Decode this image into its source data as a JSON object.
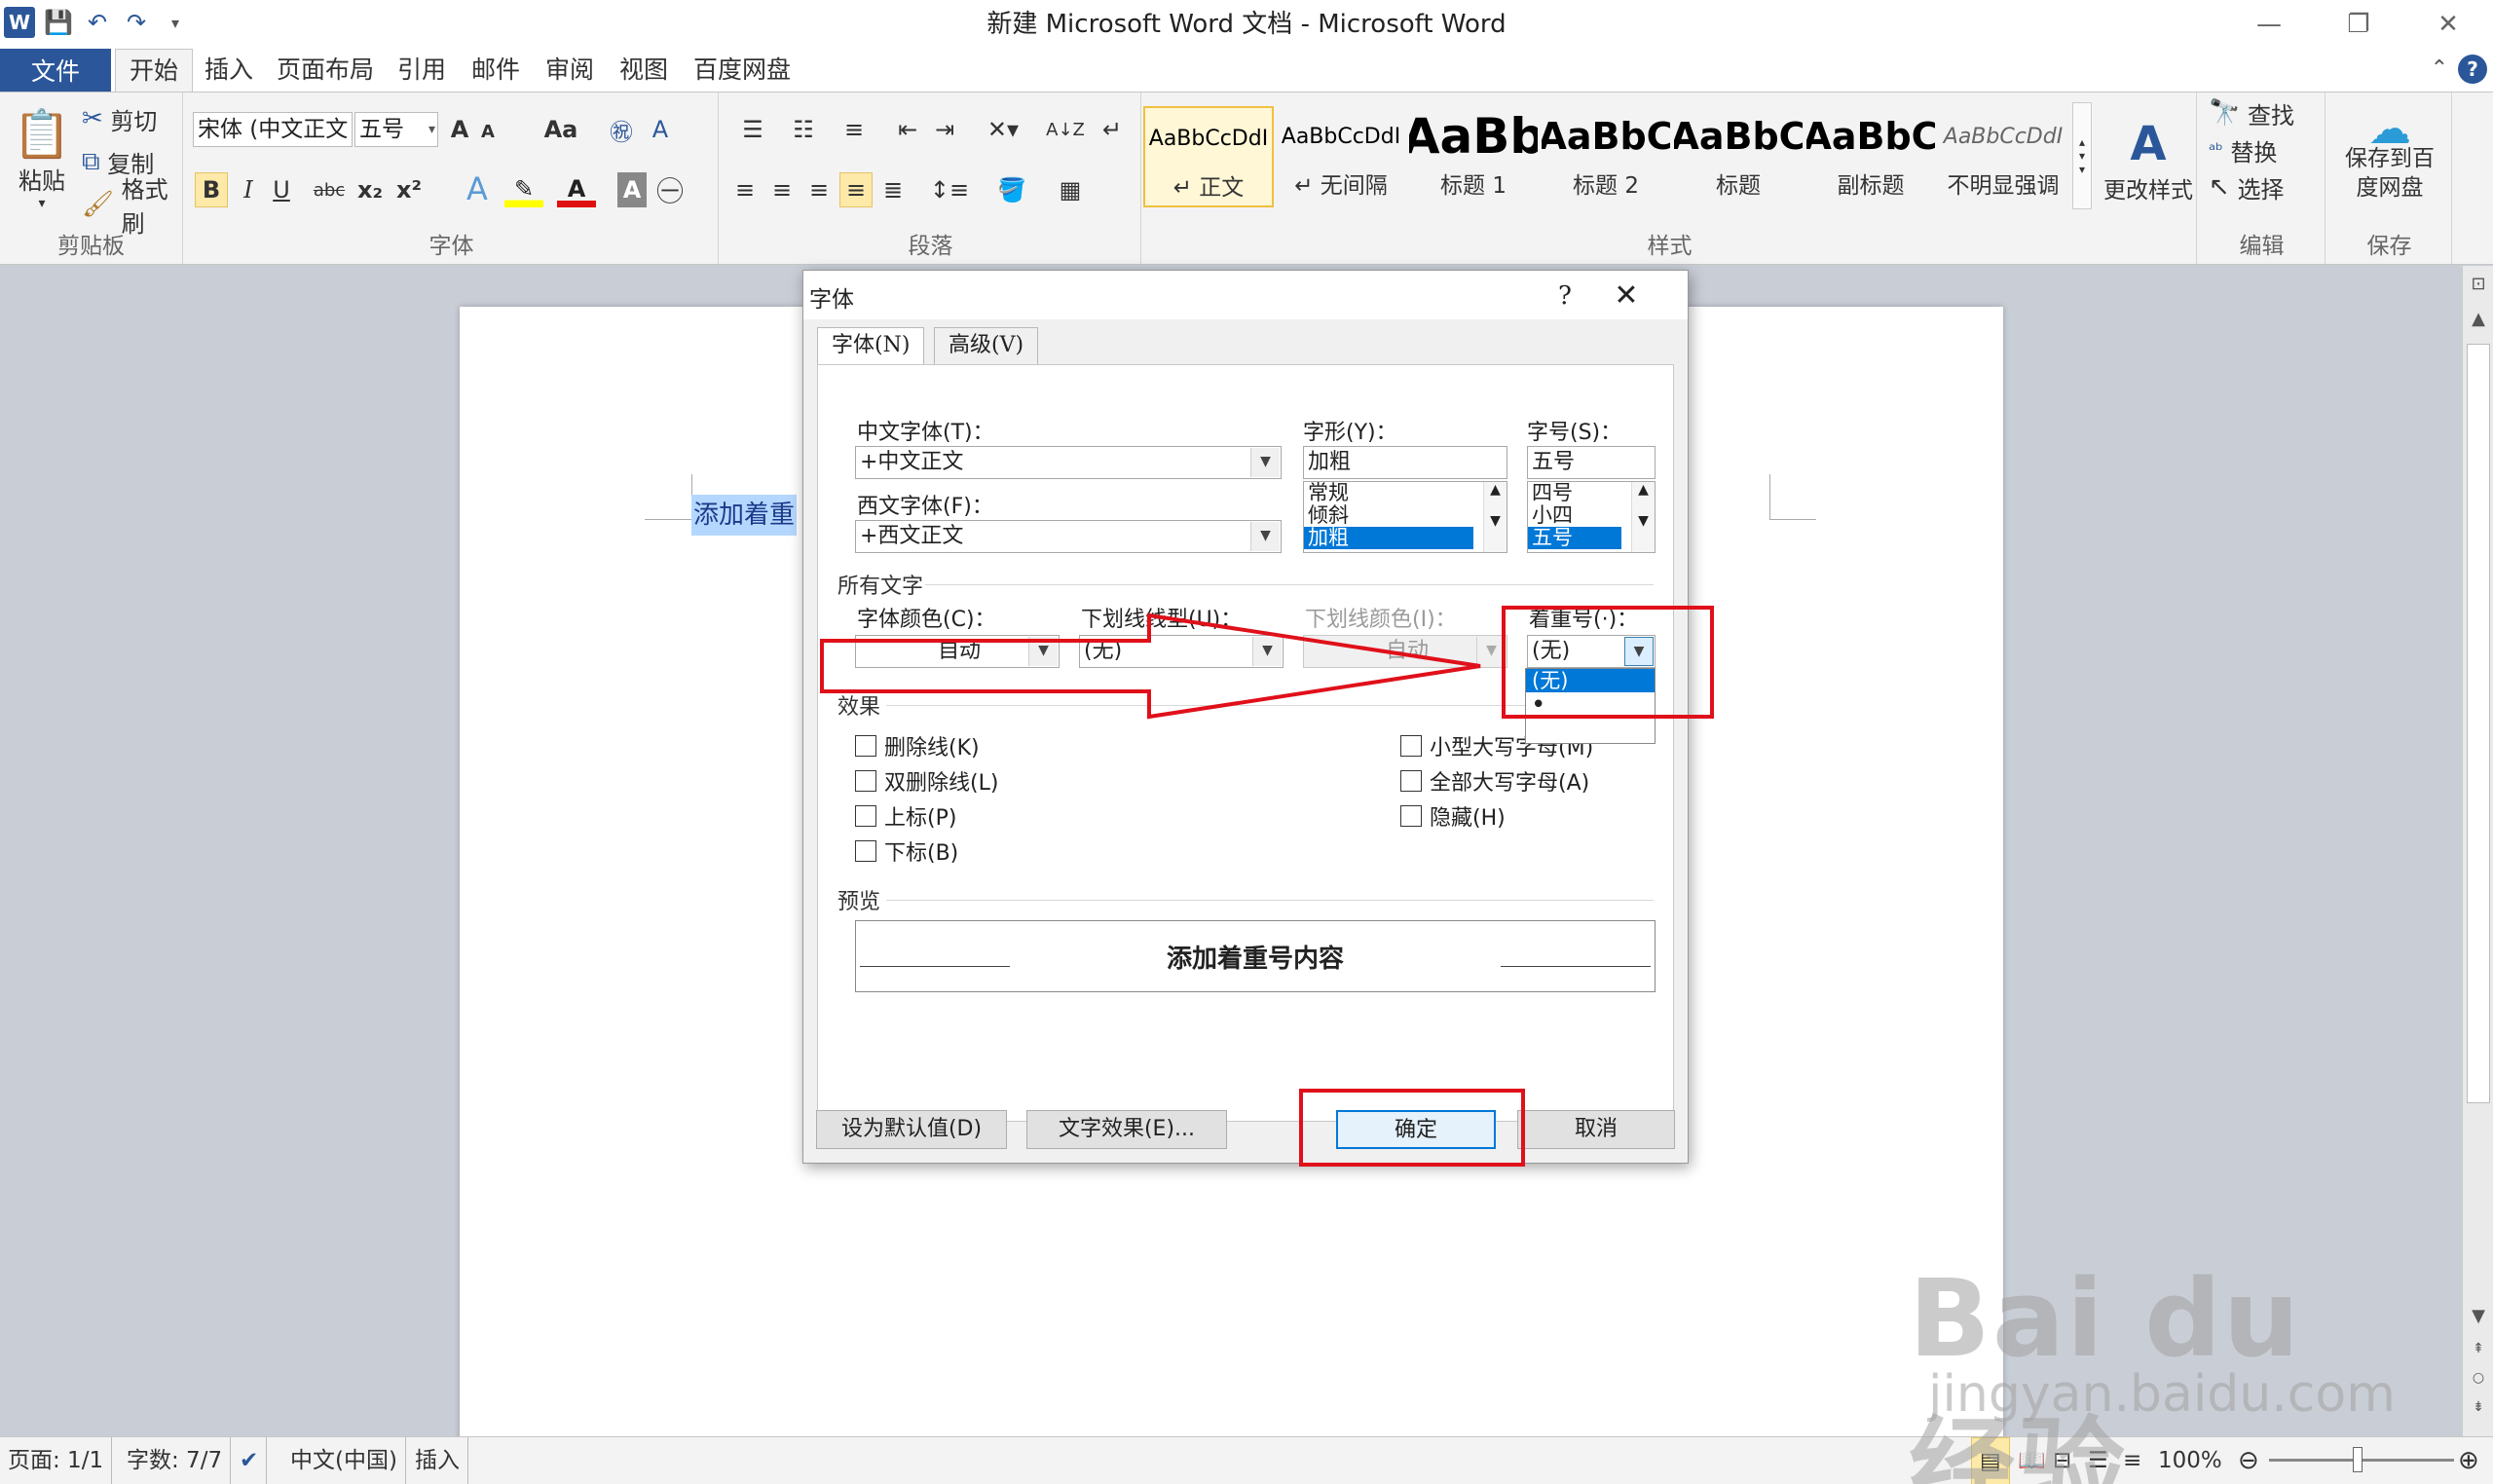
{
  "window": {
    "title": "新建 Microsoft Word 文档 - Microsoft Word",
    "minimize": "—",
    "restore": "❐",
    "close": "✕"
  },
  "qat": {
    "word_logo": "W",
    "save": "💾",
    "undo": "↶",
    "redo": "↷",
    "customize": "▾"
  },
  "tabs": {
    "file": "文件",
    "items": [
      "开始",
      "插入",
      "页面布局",
      "引用",
      "邮件",
      "审阅",
      "视图",
      "百度网盘"
    ],
    "active": "开始",
    "help": "?",
    "collapse": "⌃"
  },
  "ribbon": {
    "clipboard": {
      "label": "剪贴板",
      "paste": "粘贴",
      "cut": "剪切",
      "copy": "复制",
      "format_painter": "格式刷"
    },
    "font": {
      "label": "字体",
      "font_name": "宋体 (中文正文",
      "font_size": "五号",
      "grow": "A",
      "shrink": "A",
      "change_case": "Aa",
      "clear_format": "A",
      "bold": "B",
      "italic": "I",
      "underline": "U",
      "strike": "abc",
      "subscript": "x₂",
      "superscript": "x²",
      "text_effect": "A",
      "highlight": "✎",
      "font_color": "A",
      "char_shading": "A",
      "enclose": "㊀"
    },
    "paragraph": {
      "label": "段落",
      "sort": "A↓Z",
      "show_marks": "↵"
    },
    "styles": {
      "label": "样式",
      "items": [
        {
          "sample": "AaBbCcDdI",
          "name": "正文",
          "mark": "↵"
        },
        {
          "sample": "AaBbCcDdI",
          "name": "无间隔",
          "mark": "↵"
        },
        {
          "sample": "AaBb",
          "name": "标题 1"
        },
        {
          "sample": "AaBbC",
          "name": "标题 2"
        },
        {
          "sample": "AaBbC",
          "name": "标题"
        },
        {
          "sample": "AaBbC",
          "name": "副标题"
        },
        {
          "sample": "AaBbCcDdI",
          "name": "不明显强调"
        }
      ],
      "change_styles": "更改样式"
    },
    "editing": {
      "label": "编辑",
      "find": "查找",
      "replace": "替换",
      "select": "选择"
    },
    "save": {
      "label": "保存",
      "button_line1": "保存到百",
      "button_line2": "度网盘"
    }
  },
  "document": {
    "text": "添加着重"
  },
  "dialog": {
    "title": "字体",
    "help": "?",
    "close": "✕",
    "tabs": [
      "字体(N)",
      "高级(V)"
    ],
    "chinese_font_label": "中文字体(T)：",
    "chinese_font_value": "+中文正文",
    "western_font_label": "西文字体(F)：",
    "western_font_value": "+西文正文",
    "style_label": "字形(Y)：",
    "style_value": "加粗",
    "style_list": [
      "常规",
      "倾斜",
      "加粗"
    ],
    "style_selected": 2,
    "size_label": "字号(S)：",
    "size_value": "五号",
    "size_list": [
      "四号",
      "小四",
      "五号"
    ],
    "size_selected": 2,
    "all_text_section": "所有文字",
    "font_color_label": "字体颜色(C)：",
    "font_color_value": "自动",
    "underline_style_label": "下划线线型(U)：",
    "underline_style_value": "(无)",
    "underline_color_label": "下划线颜色(I)：",
    "underline_color_value": "自动",
    "emphasis_label": "着重号(·)：",
    "emphasis_value": "(无)",
    "emphasis_options": [
      "(无)",
      "•"
    ],
    "emphasis_selected": 0,
    "effects_section": "效果",
    "effects_left": [
      "删除线(K)",
      "双删除线(L)",
      "上标(P)",
      "下标(B)"
    ],
    "effects_right": [
      "小型大写字母(M)",
      "全部大写字母(A)",
      "隐藏(H)"
    ],
    "preview_section": "预览",
    "preview_text": "添加着重号内容",
    "set_default_button": "设为默认值(D)",
    "text_effects_button": "文字效果(E)...",
    "ok_button": "确定",
    "cancel_button": "取消"
  },
  "status": {
    "page": "页面: 1/1",
    "words": "字数: 7/7",
    "language": "中文(中国)",
    "mode": "插入",
    "zoom": "100%"
  },
  "watermark": {
    "main": "Bai du 经验",
    "sub": "jingyan.baidu.com"
  },
  "colors": {
    "accent": "#2b579a",
    "selection": "#0078d7",
    "annotation": "#e0101a",
    "highlight": "#b4d7ff"
  }
}
